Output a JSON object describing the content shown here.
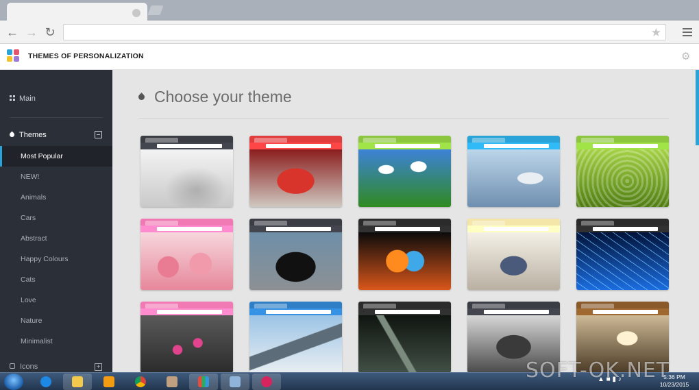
{
  "app": {
    "title": "THEMES OF PERSONALIZATION"
  },
  "sidebar": {
    "main_label": "Main",
    "themes_label": "Themes",
    "items": [
      {
        "label": "Most Popular",
        "active": true
      },
      {
        "label": "NEW!"
      },
      {
        "label": "Animals"
      },
      {
        "label": "Cars"
      },
      {
        "label": "Abstract"
      },
      {
        "label": "Happy Colours"
      },
      {
        "label": "Cats"
      },
      {
        "label": "Love"
      },
      {
        "label": "Nature"
      },
      {
        "label": "Minimalist"
      }
    ],
    "icons_label": "Icons"
  },
  "content": {
    "heading": "Choose your theme",
    "themes": [
      {
        "frame": "#3a3d44",
        "scene": [
          "#f3f3f3",
          "#c9c9c9"
        ],
        "art": "pencil"
      },
      {
        "frame": "#e23d3d",
        "scene": [
          "#8b1e1e",
          "#cfc8c0"
        ],
        "art": "car-red"
      },
      {
        "frame": "#8cc63f",
        "scene": [
          "#3d82d8",
          "#2f8a1f"
        ],
        "art": "field"
      },
      {
        "frame": "#2aa3d8",
        "scene": [
          "#bcd6ea",
          "#6f8fb0"
        ],
        "art": "horse"
      },
      {
        "frame": "#8cc63f",
        "scene": [
          "#a5d246",
          "#4f7d12"
        ],
        "art": "flower-green"
      },
      {
        "frame": "#f27ab4",
        "scene": [
          "#f6d6dc",
          "#e6889b"
        ],
        "art": "roses"
      },
      {
        "frame": "#3a3d44",
        "scene": [
          "#6f8fa8",
          "#8c9094"
        ],
        "art": "car-black"
      },
      {
        "frame": "#2b2b2b",
        "scene": [
          "#0b0b0b",
          "#d9561a"
        ],
        "art": "fire-heart"
      },
      {
        "frame": "#f4e6a8",
        "scene": [
          "#f4f0e6",
          "#b9b0a2"
        ],
        "art": "love-lock"
      },
      {
        "frame": "#2b2b2b",
        "scene": [
          "#02133a",
          "#1b6de0"
        ],
        "art": "lightning"
      },
      {
        "frame": "#f27ab4",
        "scene": [
          "#5a5a5a",
          "#2b2b2b"
        ],
        "art": "bleeding-hearts"
      },
      {
        "frame": "#2f7fc6",
        "scene": [
          "#9cc4e6",
          "#e8eef2"
        ],
        "art": "mountains"
      },
      {
        "frame": "#2b2b2b",
        "scene": [
          "#101510",
          "#415045"
        ],
        "art": "abstract-dark"
      },
      {
        "frame": "#3a3d44",
        "scene": [
          "#d7d7d7",
          "#4a4a4a"
        ],
        "art": "soldier"
      },
      {
        "frame": "#8b5a2b",
        "scene": [
          "#cdb995",
          "#4b3a26"
        ],
        "art": "sky-sunset"
      }
    ]
  },
  "taskbar": {
    "time": "5:36 PM",
    "date": "10/23/2015"
  },
  "watermark": "SOFT-OK.NET",
  "colors": {
    "accent": "#2aa3d8",
    "sidebar": "#2b2f38"
  }
}
